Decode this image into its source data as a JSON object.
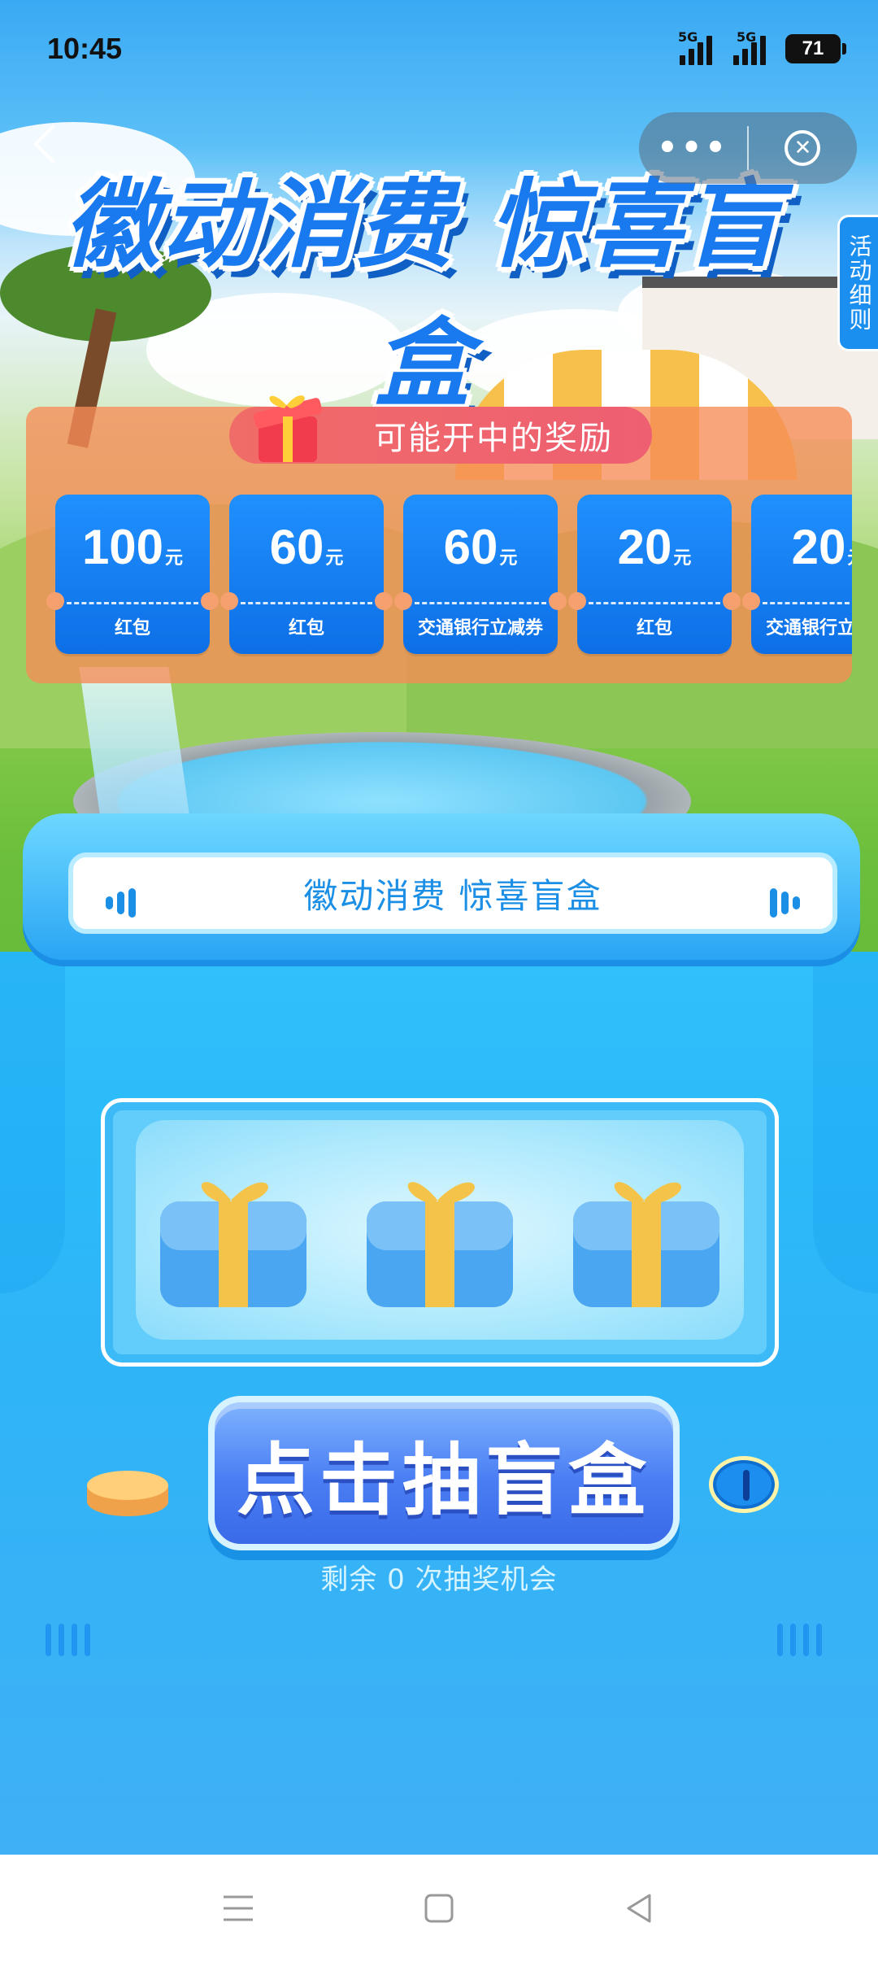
{
  "status_bar": {
    "time": "10:45",
    "signal1": "5G",
    "signal2": "5G",
    "battery": "71"
  },
  "capsule": {
    "more": "•••",
    "close": "✕"
  },
  "rules_tab": "活动细则",
  "hero_title": "徽动消费 惊喜盲盒",
  "prizes": {
    "ribbon": "可能开中的奖励",
    "items": [
      {
        "amount": "100",
        "unit": "元",
        "name": "红包"
      },
      {
        "amount": "60",
        "unit": "元",
        "name": "红包"
      },
      {
        "amount": "60",
        "unit": "元",
        "name": "交通银行立减券"
      },
      {
        "amount": "20",
        "unit": "元",
        "name": "红包"
      },
      {
        "amount": "20",
        "unit": "元",
        "name": "交通银行立减券"
      }
    ]
  },
  "machine": {
    "banner": "徽动消费 惊喜盲盒",
    "button": "点击抽盲盒",
    "remaining": "剩余 0 次抽奖机会"
  },
  "colors": {
    "primary": "#1b8fe6",
    "prize_card": "#1479f0",
    "ribbon": "#ee6470",
    "machine": "#2bbaf9"
  },
  "icons": [
    "back-icon",
    "more-icon",
    "close-icon",
    "gift-icon",
    "coin-icon",
    "menu-icon",
    "home-icon",
    "back-triangle-icon"
  ]
}
